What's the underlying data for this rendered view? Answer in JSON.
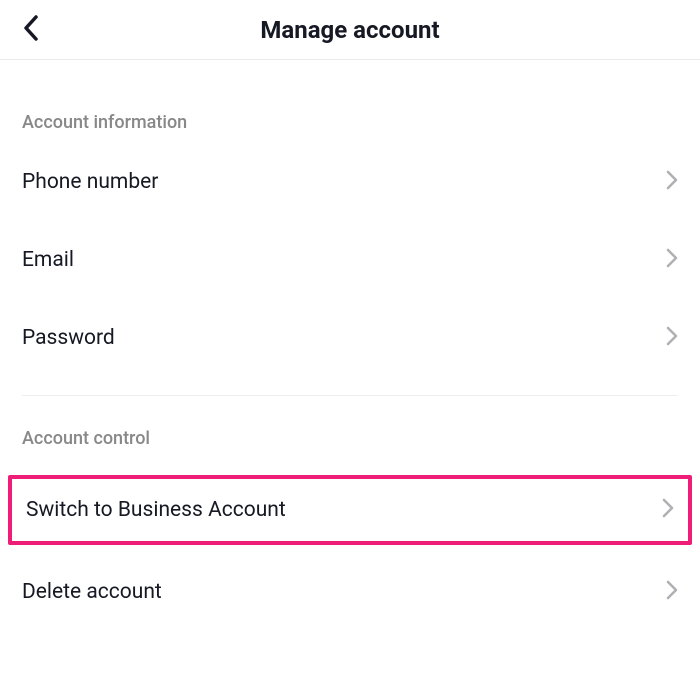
{
  "header": {
    "title": "Manage account"
  },
  "sections": {
    "info": {
      "header": "Account information",
      "phone": "Phone number",
      "email": "Email",
      "password": "Password"
    },
    "control": {
      "header": "Account control",
      "switch_business": "Switch to Business Account",
      "delete_account": "Delete account"
    }
  }
}
